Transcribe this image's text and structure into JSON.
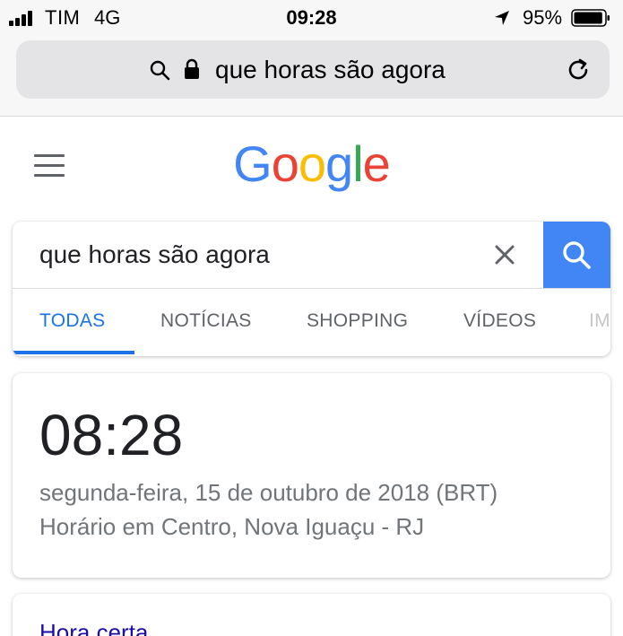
{
  "status_bar": {
    "carrier": "TIM",
    "network": "4G",
    "time": "09:28",
    "battery": "95%",
    "battery_level": 0.95,
    "icons": [
      "signal-icon",
      "location-arrow-icon",
      "battery-icon"
    ]
  },
  "browser": {
    "url_text": "que horas são agora",
    "icons": [
      "search-icon",
      "lock-icon",
      "reload-icon"
    ]
  },
  "google": {
    "logo_letters": [
      "G",
      "o",
      "o",
      "g",
      "l",
      "e"
    ],
    "logo_colors": [
      "#4285f4",
      "#ea4335",
      "#fbbc05",
      "#4285f4",
      "#34a853",
      "#ea4335"
    ],
    "search_query": "que horas são agora",
    "accent_color": "#4285f4",
    "tabs": [
      {
        "label": "TODAS",
        "active": true
      },
      {
        "label": "NOTÍCIAS",
        "active": false
      },
      {
        "label": "SHOPPING",
        "active": false
      },
      {
        "label": "VÍDEOS",
        "active": false
      },
      {
        "label": "IM",
        "active": false
      }
    ]
  },
  "time_card": {
    "time": "08:28",
    "date": "segunda-feira, 15 de outubro de 2018 (BRT)",
    "location": "Horário em Centro, Nova Iguaçu - RJ"
  },
  "next_card": {
    "title": "Hora certa"
  }
}
